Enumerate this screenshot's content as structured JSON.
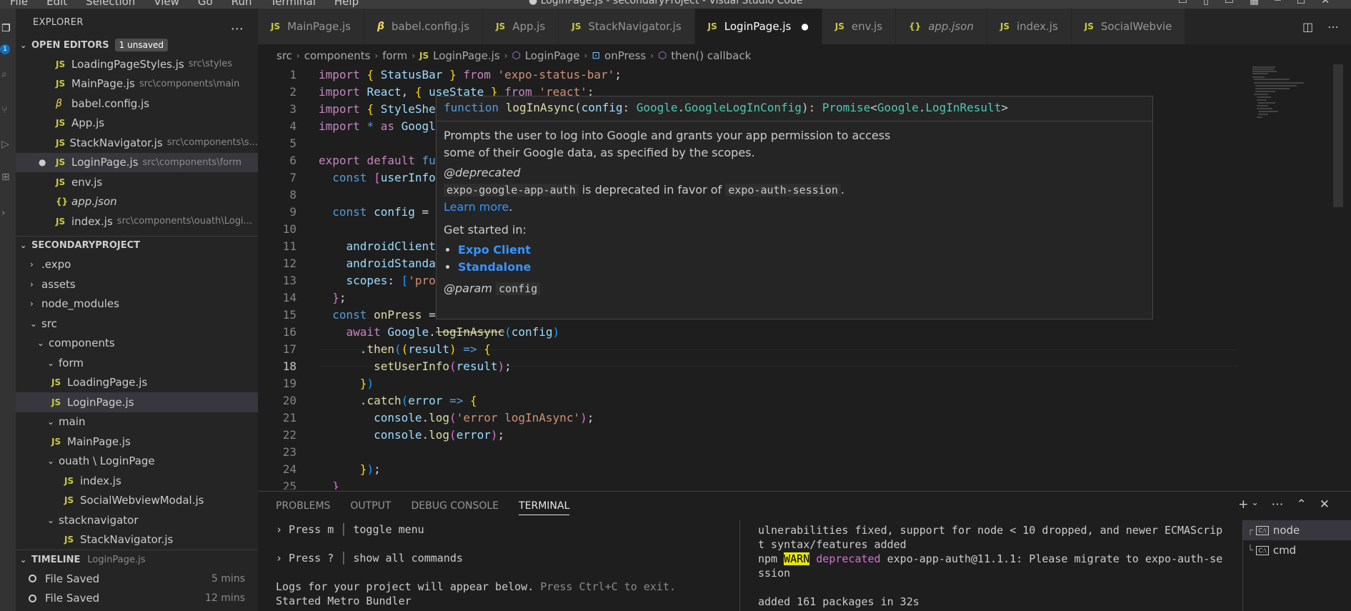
{
  "titlebar": {
    "menu": [
      "File",
      "Edit",
      "Selection",
      "View",
      "Go",
      "Run",
      "Terminal",
      "Help"
    ],
    "title": "● LoginPage.js - secondaryProject - Visual Studio Code"
  },
  "activity": {
    "badge": "1"
  },
  "sidebar": {
    "header": "EXPLORER",
    "open_editors": {
      "title": "OPEN EDITORS",
      "badge": "1 unsaved",
      "items": [
        {
          "name": "LoadingPageStyles.js",
          "desc": "src\\styles"
        },
        {
          "name": "MainPage.js",
          "desc": "src\\components\\main"
        },
        {
          "name": "babel.config.js",
          "desc": ""
        },
        {
          "name": "App.js",
          "desc": ""
        },
        {
          "name": "StackNavigator.js",
          "desc": "src\\components\\s..."
        },
        {
          "name": "LoginPage.js",
          "desc": "src\\components\\form"
        },
        {
          "name": "env.js",
          "desc": ""
        },
        {
          "name": "app.json",
          "desc": ""
        },
        {
          "name": "index.js",
          "desc": "src\\components\\ouath\\Logi..."
        }
      ]
    },
    "project": {
      "title": "SECONDARYPROJECT",
      "items": [
        {
          "name": ".expo",
          "expanded": false
        },
        {
          "name": "assets",
          "expanded": false
        },
        {
          "name": "node_modules",
          "expanded": false
        },
        {
          "name": "src",
          "expanded": true
        },
        {
          "name": "components",
          "expanded": true
        },
        {
          "name": "form",
          "expanded": true
        },
        {
          "name": "LoadingPage.js"
        },
        {
          "name": "LoginPage.js"
        },
        {
          "name": "main",
          "expanded": true
        },
        {
          "name": "MainPage.js"
        },
        {
          "name": "ouath \\ LoginPage",
          "expanded": true
        },
        {
          "name": "index.js"
        },
        {
          "name": "SocialWebviewModal.js"
        },
        {
          "name": "stacknavigator",
          "expanded": true
        },
        {
          "name": "StackNavigator.js"
        }
      ]
    },
    "timeline": {
      "title": "TIMELINE",
      "file": "LoginPage.js",
      "items": [
        {
          "label": "File Saved",
          "time": "5 mins"
        },
        {
          "label": "File Saved",
          "time": "12 mins"
        }
      ]
    }
  },
  "tabs": [
    {
      "label": "MainPage.js",
      "icon": "JS"
    },
    {
      "label": "babel.config.js",
      "icon": "babel"
    },
    {
      "label": "App.js",
      "icon": "JS"
    },
    {
      "label": "StackNavigator.js",
      "icon": "JS"
    },
    {
      "label": "LoginPage.js",
      "icon": "JS",
      "active": true,
      "modified": "●"
    },
    {
      "label": "env.js",
      "icon": "JS"
    },
    {
      "label": "app.json",
      "icon": "{}"
    },
    {
      "label": "index.js",
      "icon": "JS"
    },
    {
      "label": "SocialWebvie",
      "icon": "JS"
    }
  ],
  "breadcrumb": [
    "src",
    "components",
    "form",
    "LoginPage.js",
    "LoginPage",
    "onPress",
    "then() callback"
  ],
  "editor": {
    "line_numbers": [
      "1",
      "2",
      "3",
      "4",
      "5",
      "6",
      "7",
      "8",
      "9",
      "10",
      "11",
      "12",
      "13",
      "14",
      "15",
      "16",
      "17",
      "18",
      "19",
      "20",
      "21",
      "22",
      "23",
      "24",
      "25"
    ],
    "current_line": 18
  },
  "hover": {
    "signature": {
      "kw": "function",
      "name": "logInAsync",
      "param": "config",
      "ns1": "Google",
      "type1": "GoogleLogInConfig",
      "ret": "Promise",
      "ns2": "Google",
      "type2": "LogInResult"
    },
    "desc1": "Prompts the user to log into Google and grants your app permission to access",
    "desc2": "some of their Google data, as specified by the scopes.",
    "deprecated_tag": "@deprecated",
    "dep_code1": "expo-google-app-auth",
    "dep_text": "is deprecated in favor of",
    "dep_code2": "expo-auth-session",
    "learn_more": "Learn more",
    "get_started": "Get started in:",
    "links": [
      "Expo Client",
      "Standalone"
    ],
    "param_tag": "@param",
    "param_name": "config"
  },
  "panel": {
    "tabs": [
      "PROBLEMS",
      "OUTPUT",
      "DEBUG CONSOLE",
      "TERMINAL"
    ],
    "active_tab": "TERMINAL",
    "left": {
      "l1_key": "› Press m",
      "l1_desc": "toggle menu",
      "l2_key": "› Press ?",
      "l2_desc": "show all commands",
      "l3": "Logs for your project will appear below.",
      "l3_dim": "Press Ctrl+C to exit.",
      "l4": "Started Metro Bundler"
    },
    "right": {
      "l1": "ulnerabilities fixed, support for node < 10 dropped, and newer ECMAScrip",
      "l2": "t syntax/features added",
      "npm": "npm",
      "warn": "WARN",
      "deprecated": "deprecated",
      "msg": "expo-app-auth@11.1.1: Please migrate to expo-auth-se",
      "l4": "ssion",
      "l5": "added 161 packages in 32s"
    },
    "terminals": [
      "node",
      "cmd"
    ]
  }
}
